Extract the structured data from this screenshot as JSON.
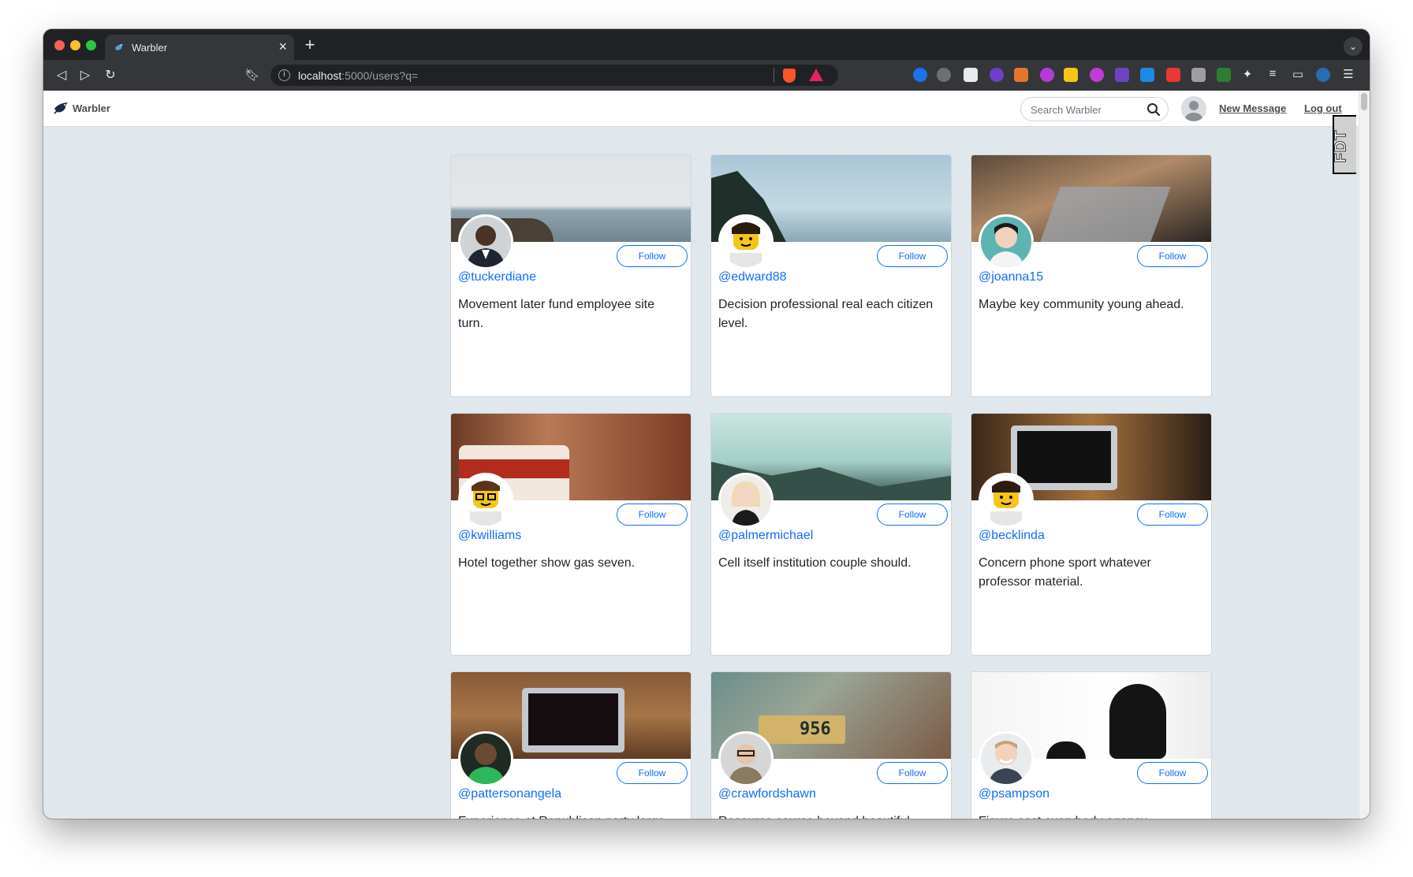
{
  "browser": {
    "tab_title": "Warbler",
    "url_host": "localhost",
    "url_path": ":5000/users?q="
  },
  "navbar": {
    "brand": "Warbler",
    "search_placeholder": "Search Warbler",
    "new_message": "New Message",
    "logout": "Log out",
    "devtools_tab": "FDT"
  },
  "colors": {
    "link": "#0d6efd",
    "page_bg": "#e1e8ed"
  },
  "follow_label": "Follow",
  "cards": [
    {
      "handle": "@tuckerdiane",
      "bio": "Movement later fund employee site turn."
    },
    {
      "handle": "@edward88",
      "bio": "Decision professional real each citizen level."
    },
    {
      "handle": "@joanna15",
      "bio": "Maybe key community young ahead."
    },
    {
      "handle": "@kwilliams",
      "bio": "Hotel together show gas seven."
    },
    {
      "handle": "@palmermichael",
      "bio": "Cell itself institution couple should."
    },
    {
      "handle": "@becklinda",
      "bio": "Concern phone sport whatever professor material."
    },
    {
      "handle": "@pattersonangela",
      "bio": "Experience at Republican party large"
    },
    {
      "handle": "@crawfordshawn",
      "bio": "Resource course beyond beautiful"
    },
    {
      "handle": "@psampson",
      "bio": "Figure cost everybody agency"
    }
  ],
  "plate_text": "956"
}
